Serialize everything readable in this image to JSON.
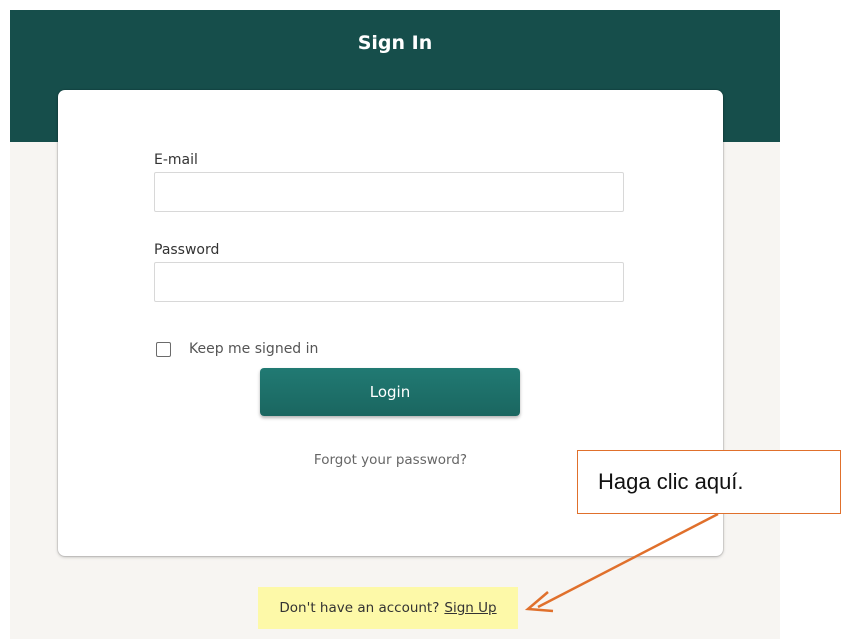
{
  "header": {
    "title": "Sign In"
  },
  "form": {
    "email_label": "E-mail",
    "email_value": "",
    "password_label": "Password",
    "password_value": "",
    "keep_signed_in_label": "Keep me signed in",
    "keep_signed_in_checked": false,
    "login_label": "Login",
    "forgot_label": "Forgot your password?"
  },
  "signup": {
    "prompt": "Don't have an account?",
    "link_label": "Sign Up"
  },
  "annotation": {
    "callout_text": "Haga clic aquí.",
    "arrow_icon": "arrow-icon"
  },
  "colors": {
    "header": "#164e4b",
    "button": "#1f736d",
    "page_bg": "#f7f5f2",
    "highlight": "#fdf9a8",
    "callout_border": "#e0702c"
  }
}
